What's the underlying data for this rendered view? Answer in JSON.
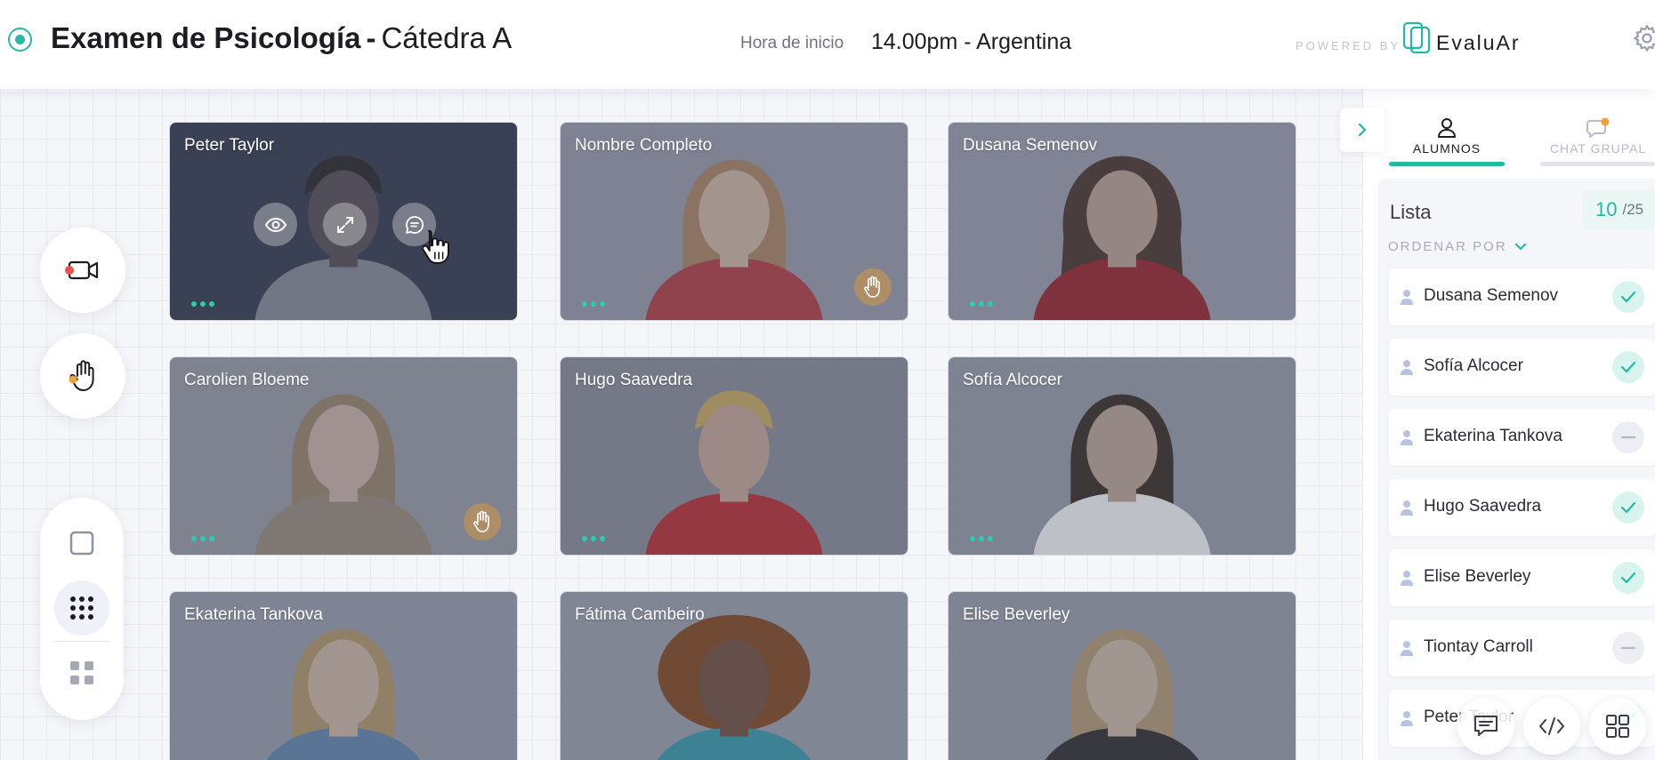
{
  "header": {
    "title_bold": "Examen de Psicología",
    "title_separator": "-",
    "title_regular": "Cátedra A",
    "start_label": "Hora de inicio",
    "start_value": "14.00pm - Argentina",
    "powered_by": "POWERED BY",
    "brand": "EvaluAr",
    "settings_icon": "gear-icon"
  },
  "rail": {
    "camera_icon": "video-camera-icon",
    "hand_icon": "raise-hand-icon",
    "layouts": [
      "single-layout-icon",
      "grid-9-layout-icon",
      "grid-4-layout-icon"
    ],
    "active_layout": "grid-9-layout-icon"
  },
  "tiles": [
    {
      "name": "Peter Taylor",
      "hand_raised": false,
      "hovered": true
    },
    {
      "name": "Nombre Completo",
      "hand_raised": true
    },
    {
      "name": "Dusana Semenov",
      "hand_raised": false
    },
    {
      "name": "Carolien Bloeme",
      "hand_raised": true
    },
    {
      "name": "Hugo Saavedra",
      "hand_raised": false
    },
    {
      "name": "Sofía Alcocer",
      "hand_raised": false
    },
    {
      "name": "Ekaterina Tankova",
      "hand_raised": false
    },
    {
      "name": "Fátima Cambeiro",
      "hand_raised": false
    },
    {
      "name": "Elise Beverley",
      "hand_raised": false
    }
  ],
  "tile_actions": [
    "eye-icon",
    "expand-icon",
    "chat-icon"
  ],
  "sidebar": {
    "tabs": [
      {
        "label": "ALUMNOS",
        "icon": "user-icon",
        "active": true
      },
      {
        "label": "CHAT GRUPAL",
        "icon": "chat-bubble-icon",
        "active": false,
        "notification": true
      }
    ],
    "list_title": "Lista",
    "count_current": "10",
    "count_total": "/25",
    "sort_label": "ORDENAR POR",
    "students": [
      {
        "name": "Dusana Semenov",
        "status": "done"
      },
      {
        "name": "Sofía Alcocer",
        "status": "done"
      },
      {
        "name": "Ekaterina Tankova",
        "status": "pending"
      },
      {
        "name": "Hugo Saavedra",
        "status": "done"
      },
      {
        "name": "Elise Beverley",
        "status": "done"
      },
      {
        "name": "Tiontay Carroll",
        "status": "pending"
      },
      {
        "name": "Peter Taylor",
        "status": "done"
      }
    ]
  },
  "toolbar": [
    "comment-icon",
    "code-icon",
    "grid-icon"
  ],
  "colors": {
    "accent": "#25b9a4",
    "notification": "#f0a03c",
    "hand": "#be915a"
  }
}
